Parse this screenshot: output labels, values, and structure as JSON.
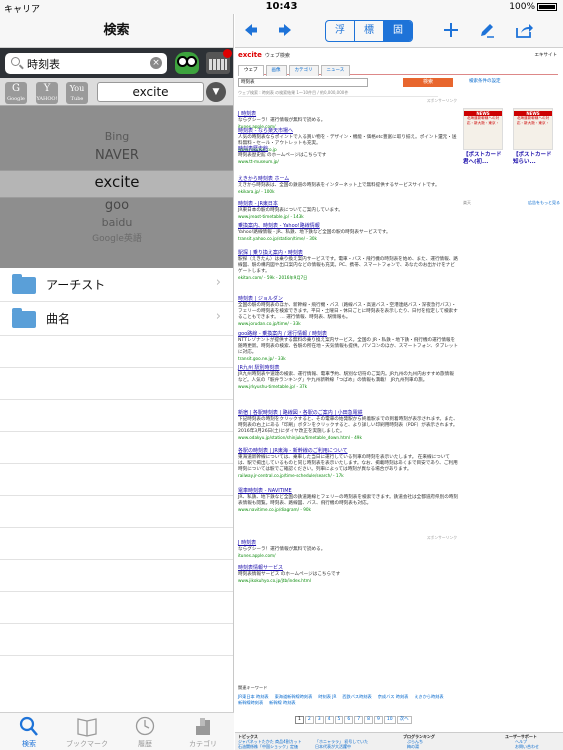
{
  "status": {
    "carrier": "キャリア",
    "time": "10:43",
    "battery": "100%"
  },
  "left": {
    "nav_title": "検索",
    "search_value": "時刻表",
    "engine_icons": [
      {
        "icon": "google-icon",
        "main": "G",
        "sub": "Google"
      },
      {
        "icon": "yahoo-icon",
        "main": "Y",
        "sub": "YAHOO!"
      },
      {
        "icon": "youtube-icon",
        "main": "You",
        "sub": "Tube"
      }
    ],
    "engine_selected": "excite",
    "picker": [
      "Bing",
      "NAVER",
      "excite",
      "goo",
      "baidu",
      "Google英語"
    ],
    "list": [
      {
        "label": "アーチスト",
        "icon": "folder-icon"
      },
      {
        "label": "曲名",
        "icon": "folder-icon"
      }
    ],
    "tabs": [
      {
        "label": "検索",
        "icon": "search-icon",
        "active": true
      },
      {
        "label": "ブックマーク",
        "icon": "book-icon",
        "active": false
      },
      {
        "label": "履歴",
        "icon": "clock-icon",
        "active": false
      },
      {
        "label": "カテゴリ",
        "icon": "category-icon",
        "active": false
      }
    ]
  },
  "right": {
    "segments": [
      "浮",
      "標",
      "固"
    ],
    "toolbar_icons": [
      "back-arrow-icon",
      "forward-arrow-icon",
      "plus-icon",
      "edit-icon",
      "share-icon"
    ],
    "web": {
      "logo": "excite",
      "logo_suffix": "ウェブ検索",
      "login": "エキサイト",
      "tabs": [
        "ウェブ",
        "画像",
        "カテゴリ",
        "ニュース"
      ],
      "query": "時刻表",
      "search_button": "検索",
      "advanced": "検索条件の設定",
      "count": "ウェブ検索 : 時刻表 の検索結果 1～10件目 / 約0,000,000件",
      "sponsored": "スポンサーリンク",
      "results": [
        {
          "title": "J 時刻表",
          "snippet": "ならグシーラ！運行情報が無料で読める。",
          "url": "itunes.apple.com/"
        },
        {
          "title": "時刻表 - なら楽天市場へ",
          "snippet": "人気の時刻表ならポイントで入る買い物を - デザイン・機能・価格etc豊富に取り揃え。ポイント還元・送料無料・セール・アウトレットも充実。",
          "url": "www.rakuten.co.jp"
        },
        {
          "title": "時刻表歴史館",
          "snippet": "時刻表歴史館 のホームページはこちらです",
          "url": "www.tt-museum.jp/"
        },
        {
          "title": "えきから時刻表 ホーム",
          "snippet": "えきから時刻表は、全国の鉄道の時刻表をインターネット上で無料提供するサービスサイトです。",
          "url": "ekikara.jp/ - 100k"
        },
        {
          "title": "時刻表 - JR東日本",
          "snippet": "JR東日本の駅の時刻表についてご案内しています。",
          "url": "www.jreast-timetable.jp/ - 143k"
        },
        {
          "title": "乗換案内、時刻表 - Yahoo!路線情報",
          "snippet": "Yahoo!路線情報 - JR、私鉄、地下鉄など全国の駅の時刻表サービスです。",
          "url": "transit.yahoo.co.jp/station/time/ - 30k"
        },
        {
          "title": "駅探 | 乗り換え案内・時刻表",
          "snippet": "駅探（えきたん）は乗り換え案内サービスです。電車・バス・飛行機の時刻表を始め、また、運行情報、路線図、駅の構内図や出口案内などの情報も充実。PC、携帯、スマートフォンで、あなたのお出かけをナビゲートします。",
          "url": "ekitan.com/ - 59k - 2016年9月7日"
        },
        {
          "title": "時刻表 | ジョルダン",
          "snippet": "全国の駅の時刻表のほか、新幹線・飛行機・バス（路線バス・高速バス・空港連絡バス・深夜急行バス）・フェリーの時刻表を検索できます。平日・土曜日・休日ごとに時刻表を表示したり、日付を指定して検索することもできます。 … 運行情報、時刻表、駅情報も。",
          "url": "www.jorudan.co.jp/time/ - 33k"
        },
        {
          "title": "goo路線 - 乗換案内 / 運行情報 / 時刻表",
          "snippet": "NTTレゾナントが提供する無料の乗り換え案内サービス。全国の JR・私鉄・地下鉄・飛行機の運行情報を随時更新。時刻表の検索、各駅の所在地・天気情報も提供。パソコンのほか、スマートフォン、タブレットに対応。",
          "url": "transit.goo.ne.jp/ - 33k"
        },
        {
          "title": "JR九州 駅別時刻表",
          "snippet": "JR九州時刻表や速達の検索、運行情報、電車予約、駅別な切符のご案内。JR九州の九州内おすすめ旅情報など。人気の「駅弁ランキング」や九州新幹線「つばめ」の情報も満載！ JR九州列車の旅。",
          "url": "www.jrkyushu-timetable.jp/ - 37k"
        },
        {
          "title": "新宿 | 各駅時刻表 | 路線図・各駅のご案内 | 小田急電鉄",
          "snippet": "下記時刻表の時刻をクリックすると、その電車の始発駅から終着駅までの到着時刻が表示されます。また、時刻表の右上にある「印刷」ボタンをクリックすると、より詳しい印刷用時刻表（PDF）が表示されます。 2016年3月26日(土)にダイヤ改正を実施しました。",
          "url": "www.odakyu.jp/station/shinjuku/timetable_down.html - 49k"
        },
        {
          "title": "各駅の時刻表 | JR東海 - 新幹線のご利用について",
          "snippet": "東海道新幹線については、乗車した当日に運行している列車の時刻を表示いたします。 在来線については、駅で掲出しているものと同じ時刻表を表示いたします。なお、掲載時刻はあくまで目安であり、ご利用時刻については駅でご確認ください。列車によっては時刻が異なる場合があります。",
          "url": "railway.jr-central.co.jp/time-schedule/search/ - 17k"
        },
        {
          "title": "電車時刻表 - NAVITIME",
          "snippet": "JR、私鉄、地下鉄など全国の鉄道路線とフェリーの時刻表を検索できます。鉄道会社は全都道府県別の時刻表情報も閲覧。時刻表、路線図、バス、飛行機の時刻表も対応。",
          "url": "www.navitime.co.jp/diagram/ - 90k"
        },
        {
          "title": "J 時刻表",
          "snippet": "ならグシーラ！運行情報が無料で読める。",
          "url": "itunes.apple.com/"
        },
        {
          "title": "時刻表情報サービス",
          "snippet": "時刻表情報サービス のホームページはこちらです",
          "url": "www.jikokuhyo.co.jp/jtb/index.html"
        }
      ],
      "ads": [
        {
          "badge": "NEWS",
          "img_text": "北海道新幹線への対応・新大阪・東京・",
          "caption": "【ポストカード君へ(初..."
        },
        {
          "badge": "NEWS",
          "img_text": "北海道新幹線への対応・新大阪・東京・",
          "caption": "【ポストカード知らい..."
        }
      ],
      "ad_label": "楽天",
      "ad_more": "広告をもっと見る",
      "related_label": "関連キーワード",
      "related": [
        "JR東日本 時刻表",
        "東海道新幹線時刻表",
        "時刻表 JR",
        "西鉄バス時刻表",
        "京成バス 時刻表",
        "えきから時刻表",
        "新幹線時刻表",
        "新幹線 時刻表"
      ],
      "pages": [
        "1",
        "2",
        "3",
        "4",
        "5",
        "6",
        "7",
        "8",
        "9",
        "10",
        "次へ"
      ],
      "footer": {
        "topics_label": "トピックス",
        "topics": [
          "ジャパネットたかた 商品4割カット",
          "石油関係株「中国ショック」定価",
          "中川環境相が「連続ドラマ」人気"
        ],
        "topics2": [
          "「ホニャララ」 初号していた",
          "日本代表が大活躍中",
          "上戸彩と中居に記事"
        ],
        "ranking_label": "ブログランキング",
        "ranking": [
          "ぶらんち",
          "梅の湯",
          "ゲスの極み乙女"
        ],
        "support_label": "ユーザーサポート",
        "support": [
          "ヘルプ",
          "お問い合わせ",
          "サイトマップ"
        ]
      }
    }
  }
}
